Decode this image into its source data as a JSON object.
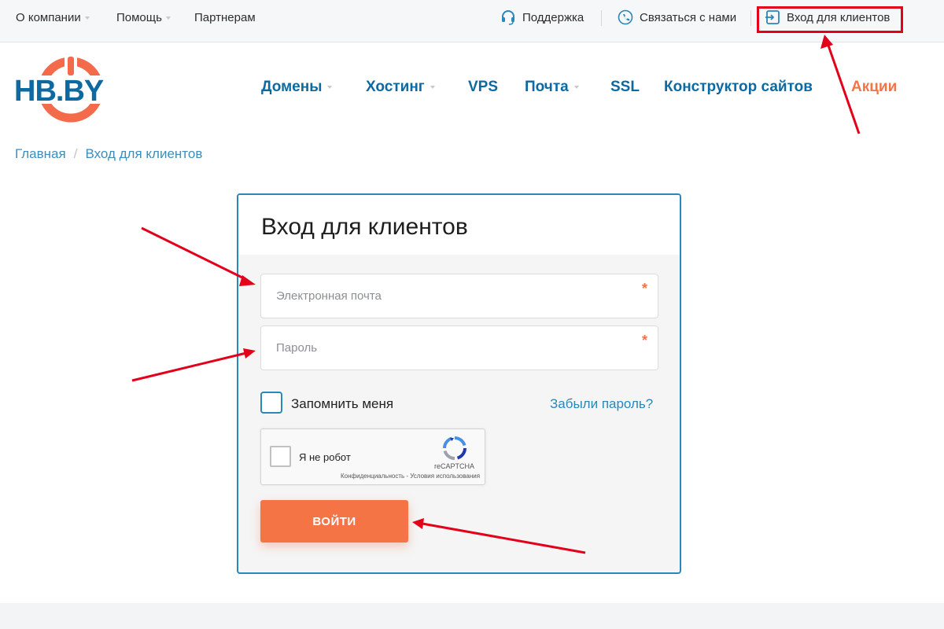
{
  "topbar": {
    "about": "О компании",
    "help": "Помощь",
    "partners": "Партнерам",
    "support": "Поддержка",
    "contact": "Связаться с нами",
    "login": "Вход для клиентов"
  },
  "logo": {
    "text": "HB.BY"
  },
  "nav": {
    "domains": "Домены",
    "hosting": "Хостинг",
    "vps": "VPS",
    "mail": "Почта",
    "ssl": "SSL",
    "builder": "Конструктор сайтов",
    "promo": "Акции"
  },
  "breadcrumb": {
    "home": "Главная",
    "separator": "/",
    "current": "Вход для клиентов"
  },
  "login_form": {
    "title": "Вход для клиентов",
    "email_placeholder": "Электронная почта",
    "email_value": "",
    "password_placeholder": "Пароль",
    "password_value": "",
    "required_mark": "*",
    "remember_label": "Запомнить меня",
    "remember_checked": false,
    "forgot_link": "Забыли пароль?",
    "submit_label": "ВОЙТИ"
  },
  "captcha": {
    "label": "Я не робот",
    "brand": "reCAPTCHA",
    "legal": "Конфиденциальность - Условия использования"
  },
  "colors": {
    "primary_blue": "#0d6aa1",
    "link_blue": "#2a87b8",
    "accent_orange": "#f47446",
    "annotation_red": "#e3001b"
  },
  "icons": {
    "support": "headset-icon",
    "contact": "phone-icon",
    "login": "login-icon",
    "captcha": "recaptcha-icon"
  }
}
